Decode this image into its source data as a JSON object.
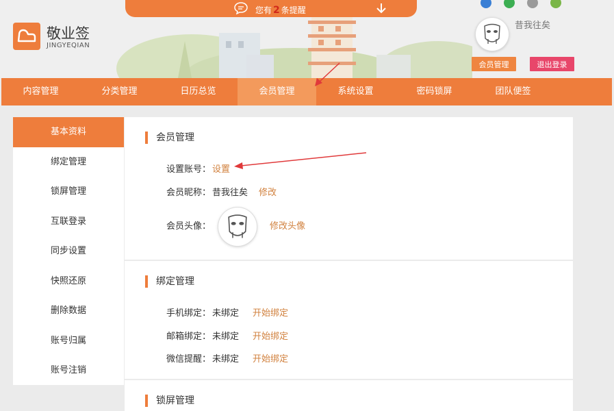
{
  "notice": {
    "prefix": "您有",
    "count": "2",
    "suffix": "条提醒"
  },
  "brand": {
    "name": "敬业签",
    "sub": "JINGYEQIAN"
  },
  "user": {
    "name": "昔我往矣"
  },
  "header_buttons": {
    "member": "会员管理",
    "logout": "退出登录"
  },
  "nav": [
    {
      "label": "内容管理"
    },
    {
      "label": "分类管理"
    },
    {
      "label": "日历总览"
    },
    {
      "label": "会员管理",
      "active": true
    },
    {
      "label": "系统设置"
    },
    {
      "label": "密码锁屏"
    },
    {
      "label": "团队便签"
    }
  ],
  "sidebar": [
    {
      "label": "基本资料",
      "active": true
    },
    {
      "label": "绑定管理"
    },
    {
      "label": "锁屏管理"
    },
    {
      "label": "互联登录"
    },
    {
      "label": "同步设置"
    },
    {
      "label": "快照还原"
    },
    {
      "label": "删除数据"
    },
    {
      "label": "账号归属"
    },
    {
      "label": "账号注销"
    }
  ],
  "member_panel": {
    "title": "会员管理",
    "account_label": "设置账号：",
    "account_link": "设置",
    "nickname_label": "会员昵称：",
    "nickname_value": "昔我往矣",
    "nickname_link": "修改",
    "avatar_label": "会员头像：",
    "avatar_link": "修改头像"
  },
  "bind_panel": {
    "title": "绑定管理",
    "rows": [
      {
        "label": "手机绑定：",
        "value": "未绑定",
        "link": "开始绑定"
      },
      {
        "label": "邮箱绑定：",
        "value": "未绑定",
        "link": "开始绑定"
      },
      {
        "label": "微信提醒：",
        "value": "未绑定",
        "link": "开始绑定"
      }
    ]
  },
  "lock_panel": {
    "title": "锁屏管理"
  },
  "colors": {
    "accent": "#ee7d3c",
    "logout": "#e8466a",
    "link": "#d1813e"
  }
}
